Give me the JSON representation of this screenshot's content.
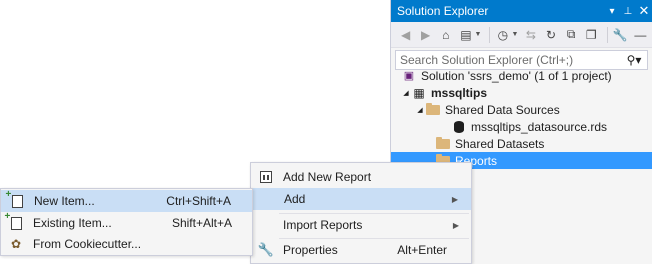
{
  "solution_explorer": {
    "title": "Solution Explorer",
    "title_buttons": {
      "dropdown": "▾",
      "pin": "⊥",
      "close": "✕"
    },
    "search_placeholder": "Search Solution Explorer (Ctrl+;)",
    "tree": {
      "solution": "Solution 'ssrs_demo' (1 of 1 project)",
      "project": "mssqltips",
      "shared_data_sources": "Shared Data Sources",
      "datasource": "mssqltips_datasource.rds",
      "shared_datasets": "Shared Datasets",
      "reports": "Reports"
    }
  },
  "context_menu": {
    "items": [
      {
        "label": "Add New Report",
        "shortcut": "",
        "icon": "report-icon"
      },
      {
        "label": "Add",
        "shortcut": "",
        "icon": ""
      },
      {
        "label": "Import Reports",
        "shortcut": "",
        "icon": ""
      },
      {
        "label": "Properties",
        "shortcut": "Alt+Enter",
        "icon": "wrench-icon"
      }
    ]
  },
  "submenu": {
    "items": [
      {
        "label": "New Item...",
        "shortcut": "Ctrl+Shift+A",
        "icon": "new-item-icon"
      },
      {
        "label": "Existing Item...",
        "shortcut": "Shift+Alt+A",
        "icon": "existing-item-icon"
      },
      {
        "label": "From Cookiecutter...",
        "shortcut": "",
        "icon": "cookiecutter-icon"
      }
    ]
  },
  "colors": {
    "title_bar": "#007acc",
    "selection": "#3399ff",
    "menu_hover": "#c9def5",
    "folder": "#dcb67a"
  }
}
